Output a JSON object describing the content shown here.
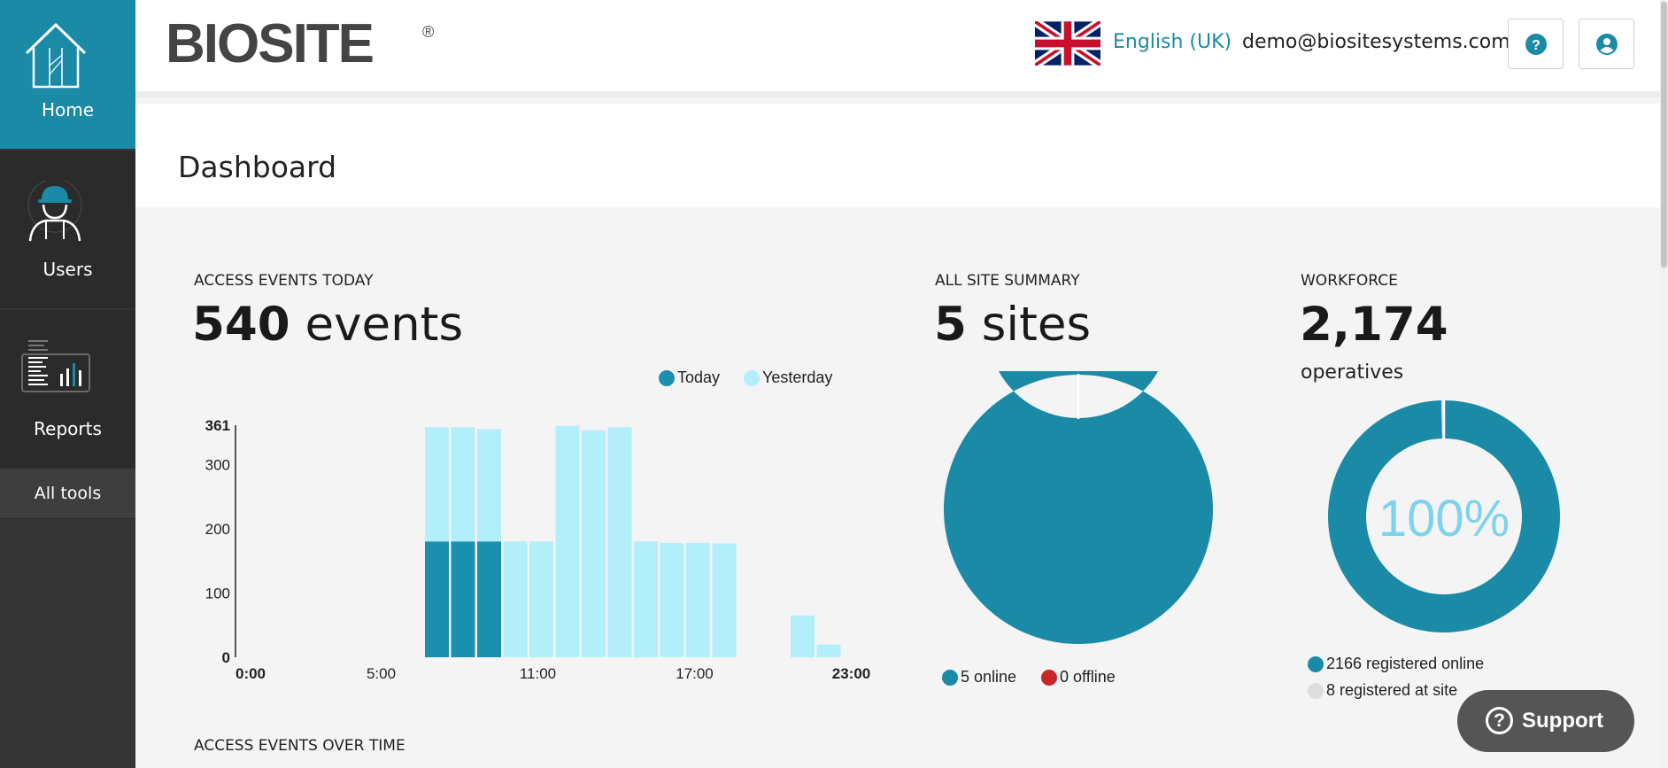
{
  "sidebar": {
    "items": [
      {
        "label": "Home",
        "icon": "house-icon",
        "active": true
      },
      {
        "label": "Users",
        "icon": "worker-icon"
      },
      {
        "label": "Reports",
        "icon": "report-icon"
      },
      {
        "label": "All tools"
      }
    ]
  },
  "header": {
    "logo_text": "BIOSITE",
    "logo_mark": "®",
    "flag_icon": "uk-flag-icon",
    "language": "English (UK)",
    "email": "demo@biositesystems.com",
    "help_icon": "question-circle-icon",
    "user_icon": "user-circle-icon"
  },
  "page": {
    "title": "Dashboard"
  },
  "access_events": {
    "title": "ACCESS EVENTS TODAY",
    "count": "540",
    "unit": "events"
  },
  "site_summary": {
    "title": "ALL SITE SUMMARY",
    "count": "5",
    "unit": "sites",
    "legend_online": "5 online",
    "legend_offline": "0 offline"
  },
  "workforce": {
    "title": "WORKFORCE",
    "count": "2,174",
    "subtitle": "operatives",
    "percent_label": "100%",
    "legend_online": "2166 registered online",
    "legend_site": "8 registered at site"
  },
  "over_time": {
    "title": "ACCESS EVENTS OVER TIME"
  },
  "support": {
    "label": "Support"
  },
  "colors": {
    "primary": "#1b8aa6",
    "today": "#1b8fae",
    "yesterday": "#b3eefb",
    "offline": "#c62828",
    "site_registered": "#dddddd",
    "percent_text": "#7dd3ee"
  },
  "chart_data": [
    {
      "type": "bar",
      "stacked": false,
      "x_tick_labels": [
        "0:00",
        "5:00",
        "11:00",
        "17:00",
        "23:00"
      ],
      "y_tick_labels": [
        "0",
        "100",
        "200",
        "300",
        "361"
      ],
      "ylim": [
        0,
        361
      ],
      "hours": [
        7,
        8,
        9,
        10,
        11,
        12,
        13,
        14,
        15,
        16,
        17,
        18,
        19,
        20,
        21,
        22
      ],
      "series": [
        {
          "name": "Today",
          "values": [
            180,
            180,
            180,
            0,
            0,
            0,
            0,
            0,
            0,
            0,
            0,
            0,
            0,
            0,
            0,
            0
          ]
        },
        {
          "name": "Yesterday",
          "values": [
            358,
            358,
            355,
            180,
            180,
            360,
            353,
            358,
            180,
            178,
            178,
            177,
            0,
            0,
            65,
            20
          ]
        }
      ],
      "legend_position": "top-right"
    },
    {
      "type": "pie",
      "donut": true,
      "categories": [
        "5 online",
        "0 offline"
      ],
      "values": [
        5,
        0
      ]
    },
    {
      "type": "pie",
      "donut": true,
      "categories": [
        "2166 registered online",
        "8 registered at site"
      ],
      "values": [
        2166,
        8
      ],
      "center_label": "100%"
    }
  ]
}
